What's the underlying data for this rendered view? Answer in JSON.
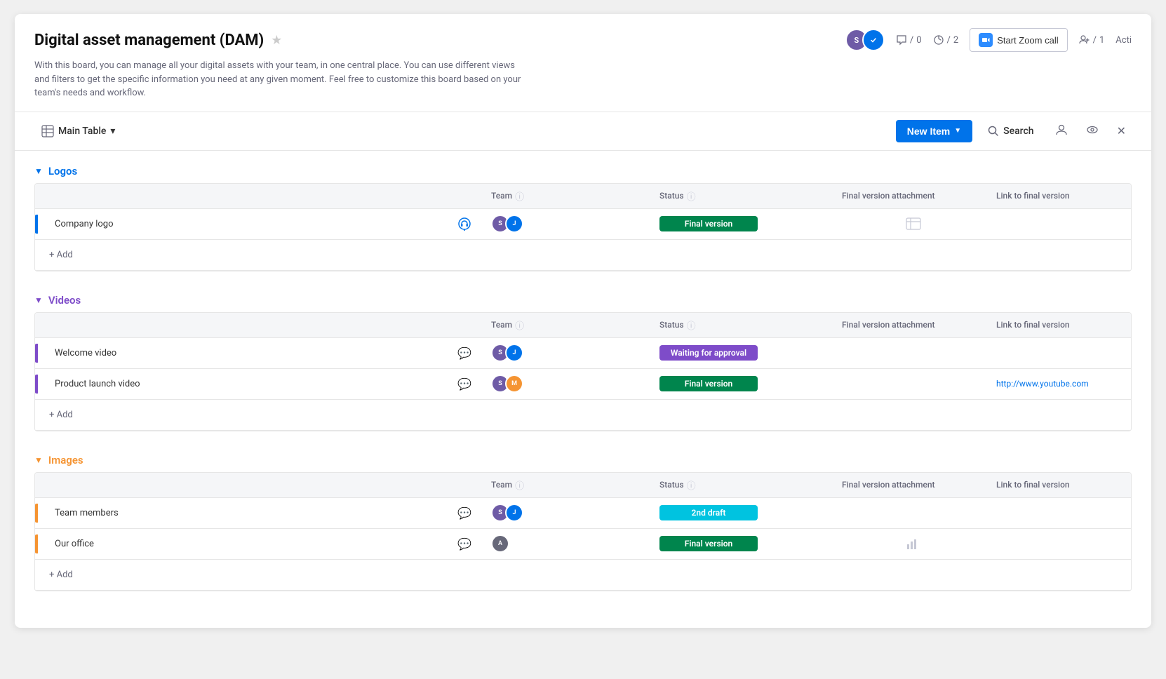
{
  "header": {
    "title": "Digital asset management (DAM)",
    "description": "With this board, you can manage all your digital assets with your team, in one central place. You can use different views and filters to get the specific information you need at any given moment. Feel free to customize this board based on your team's needs and workflow.",
    "zoom_btn_label": "Start Zoom call",
    "stat_comments": "0",
    "stat_activity": "2",
    "stat_members": "1",
    "activity_label": "Acti"
  },
  "toolbar": {
    "main_table_label": "Main Table",
    "new_item_label": "New Item",
    "search_label": "Search"
  },
  "groups": [
    {
      "id": "logos",
      "title": "Logos",
      "color": "blue",
      "columns": [
        "Team",
        "Status",
        "Final version attachment",
        "Link to final version"
      ],
      "rows": [
        {
          "name": "Company logo",
          "team": [
            {
              "color": "av-purple",
              "initials": "S"
            },
            {
              "color": "av-blue",
              "initials": "J"
            }
          ],
          "has_comment_icon": true,
          "comment_icon_color": "blue",
          "status": "Final version",
          "status_class": "status-final",
          "has_attachment": true,
          "link": ""
        }
      ],
      "add_label": "+ Add"
    },
    {
      "id": "videos",
      "title": "Videos",
      "color": "purple",
      "columns": [
        "Team",
        "Status",
        "Final version attachment",
        "Link to final version"
      ],
      "rows": [
        {
          "name": "Welcome video",
          "team": [
            {
              "color": "av-purple",
              "initials": "S"
            },
            {
              "color": "av-blue",
              "initials": "J"
            }
          ],
          "has_comment_icon": true,
          "comment_icon_color": "gray",
          "status": "Waiting for approval",
          "status_class": "status-waiting",
          "has_attachment": false,
          "link": ""
        },
        {
          "name": "Product launch video",
          "team": [
            {
              "color": "av-purple",
              "initials": "S"
            },
            {
              "color": "av-yellow",
              "initials": "M"
            }
          ],
          "has_comment_icon": true,
          "comment_icon_color": "gray",
          "status": "Final version",
          "status_class": "status-final",
          "has_attachment": false,
          "link": "http://www.youtube.com"
        }
      ],
      "add_label": "+ Add"
    },
    {
      "id": "images",
      "title": "Images",
      "color": "orange",
      "columns": [
        "Team",
        "Status",
        "Final version attachment",
        "Link to final version"
      ],
      "rows": [
        {
          "name": "Team members",
          "team": [
            {
              "color": "av-purple",
              "initials": "S"
            },
            {
              "color": "av-blue",
              "initials": "J"
            }
          ],
          "has_comment_icon": true,
          "comment_icon_color": "gray",
          "status": "2nd draft",
          "status_class": "status-draft",
          "has_attachment": false,
          "link": ""
        },
        {
          "name": "Our office",
          "team": [
            {
              "color": "av-gray",
              "initials": "A"
            }
          ],
          "has_comment_icon": true,
          "comment_icon_color": "gray",
          "status": "Final version",
          "status_class": "status-final",
          "has_attachment": true,
          "link": ""
        }
      ],
      "add_label": "+ Add"
    }
  ]
}
